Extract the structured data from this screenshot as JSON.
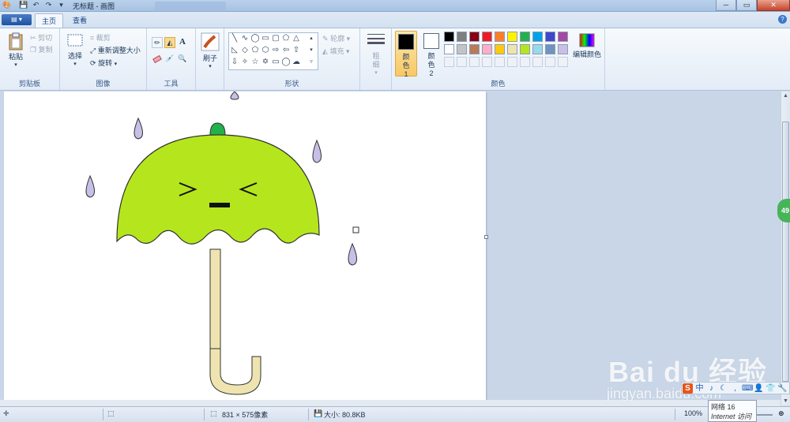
{
  "window": {
    "title": "无标题 - 画图",
    "controls": {
      "minimize": "─",
      "maximize": "▭",
      "close": "✕"
    }
  },
  "tabs": [
    {
      "label": "主页",
      "active": true
    },
    {
      "label": "查看",
      "active": false
    }
  ],
  "ribbon": {
    "clipboard": {
      "label": "剪贴板",
      "paste": "粘贴",
      "cut": "剪切",
      "copy": "复制"
    },
    "image": {
      "label": "图像",
      "select": "选择",
      "crop": "裁剪",
      "resize": "重新调整大小",
      "rotate": "旋转"
    },
    "tools": {
      "label": "工具",
      "text_tool": "A"
    },
    "brushes": {
      "label": "刷子"
    },
    "shapes": {
      "label": "形状",
      "outline": "轮廓",
      "fill": "填充"
    },
    "size": {
      "label": "粗细"
    },
    "colors": {
      "label": "颜色",
      "color1": "颜色 1",
      "color2": "颜色 2",
      "edit": "编辑颜色",
      "color1_value": "#000000",
      "color2_value": "#ffffff",
      "palette_row1": [
        "#000000",
        "#7f7f7f",
        "#880015",
        "#ed1c24",
        "#ff7f27",
        "#fff200",
        "#22b14c",
        "#00a2e8",
        "#3f48cc",
        "#a349a4"
      ],
      "palette_row2": [
        "#ffffff",
        "#c3c3c3",
        "#b97a57",
        "#ffaec9",
        "#ffc90e",
        "#efe4b0",
        "#b5e61d",
        "#99d9ea",
        "#7092be",
        "#c8bfe7"
      ]
    }
  },
  "canvas": {
    "drawing": "green umbrella with face and purple raindrops",
    "colors": {
      "canopy": "#b5e61d",
      "handle": "#efe4b0",
      "knob": "#22b14c",
      "drops": "#c8bfe7"
    }
  },
  "statusbar": {
    "dimensions": "831 × 575像素",
    "filesize": "大小: 80.8KB",
    "zoom": "100%"
  },
  "notification": {
    "badge": "49"
  },
  "watermark": {
    "brand": "Bai du 经验",
    "domain": "jingyan.baidu.com"
  },
  "tooltip": {
    "line1": "网络 16",
    "line2": "Internet 访问"
  },
  "ime": {
    "lang": "中"
  }
}
